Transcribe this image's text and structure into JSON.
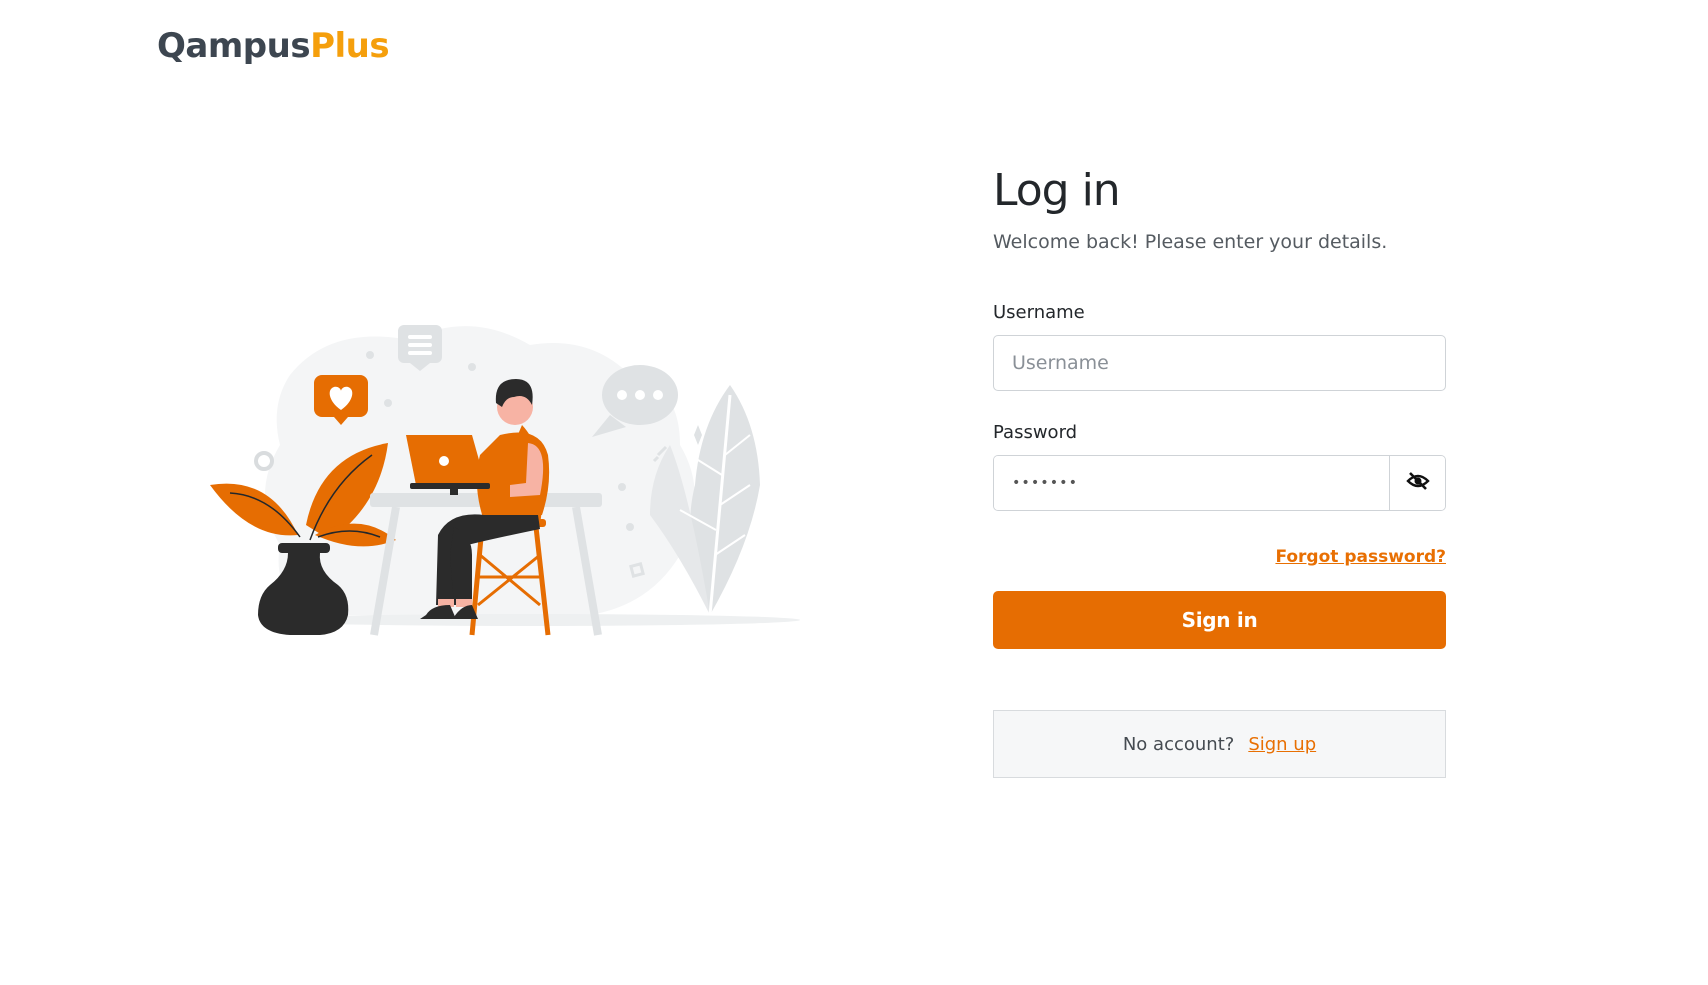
{
  "brand": {
    "part1": "Qampus",
    "part2": "Plus"
  },
  "illustration": {
    "name": "person-working-at-laptop-illustration"
  },
  "login": {
    "title": "Log in",
    "subtitle": "Welcome back! Please enter your details.",
    "username_label": "Username",
    "username_placeholder": "Username",
    "username_value": "",
    "password_label": "Password",
    "password_value": "•••••••",
    "toggle_icon": "eye-slash-icon",
    "forgot_password": "Forgot password?",
    "signin_label": "Sign in",
    "no_account_text": "No account?",
    "signup_label": "Sign up"
  },
  "colors": {
    "accent": "#e66d02",
    "brand_dark": "#3d4650",
    "brand_orange": "#f59f0c"
  }
}
